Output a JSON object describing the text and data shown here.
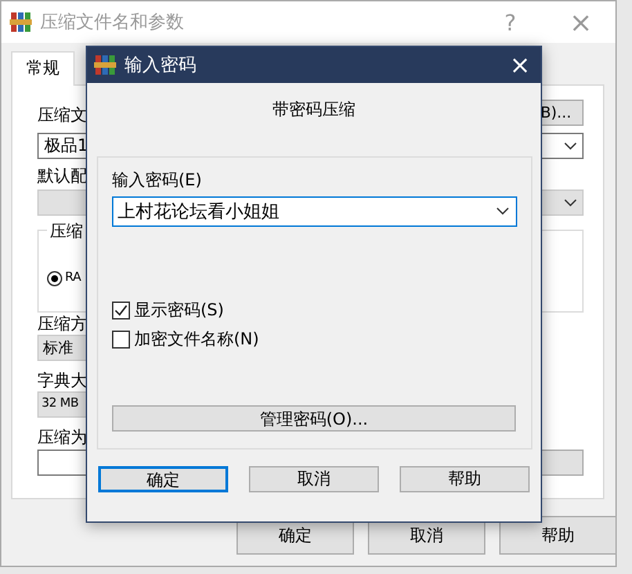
{
  "window": {
    "title": "压缩文件名和参数",
    "help": "?",
    "close": "×"
  },
  "tabs": [
    {
      "label": "常规",
      "selected": true
    }
  ],
  "form": [
    {
      "kind": "label",
      "text": "压缩文",
      "right": {
        "kind": "button",
        "text": "B)..."
      }
    },
    {
      "kind": "field",
      "text": "极品1",
      "right": {
        "kind": "dropdown"
      }
    },
    {
      "kind": "label",
      "text": "默认配"
    },
    {
      "kind": "bar",
      "right": {
        "kind": "dropdown"
      }
    },
    {
      "kind": "group",
      "text": "压缩",
      "option": {
        "label": "RA",
        "selected": true
      },
      "right": {
        "kind": "group"
      }
    },
    {
      "kind": "label",
      "text": "压缩方"
    },
    {
      "kind": "bar",
      "text": "标准"
    },
    {
      "kind": "label",
      "text": "字典大"
    },
    {
      "kind": "bar",
      "text": "32 MB"
    },
    {
      "kind": "label",
      "text": "压缩为"
    },
    {
      "kind": "field",
      "right": {
        "kind": "button"
      }
    }
  ],
  "buttons": [
    "确定",
    "取消",
    "帮助"
  ],
  "dialog": {
    "title": "输入密码",
    "close": "×",
    "heading": "带密码压缩",
    "password_label": "输入密码(E)",
    "password_value": "上村花论坛看小姐姐",
    "checkboxes": [
      {
        "label": "显示密码(S)",
        "checked": true
      },
      {
        "label": "加密文件名称(N)",
        "checked": false
      }
    ],
    "manage_button": "管理密码(O)...",
    "buttons": [
      {
        "label": "确定",
        "default": true
      },
      {
        "label": "取消",
        "default": false
      },
      {
        "label": "帮助",
        "default": false
      }
    ]
  }
}
